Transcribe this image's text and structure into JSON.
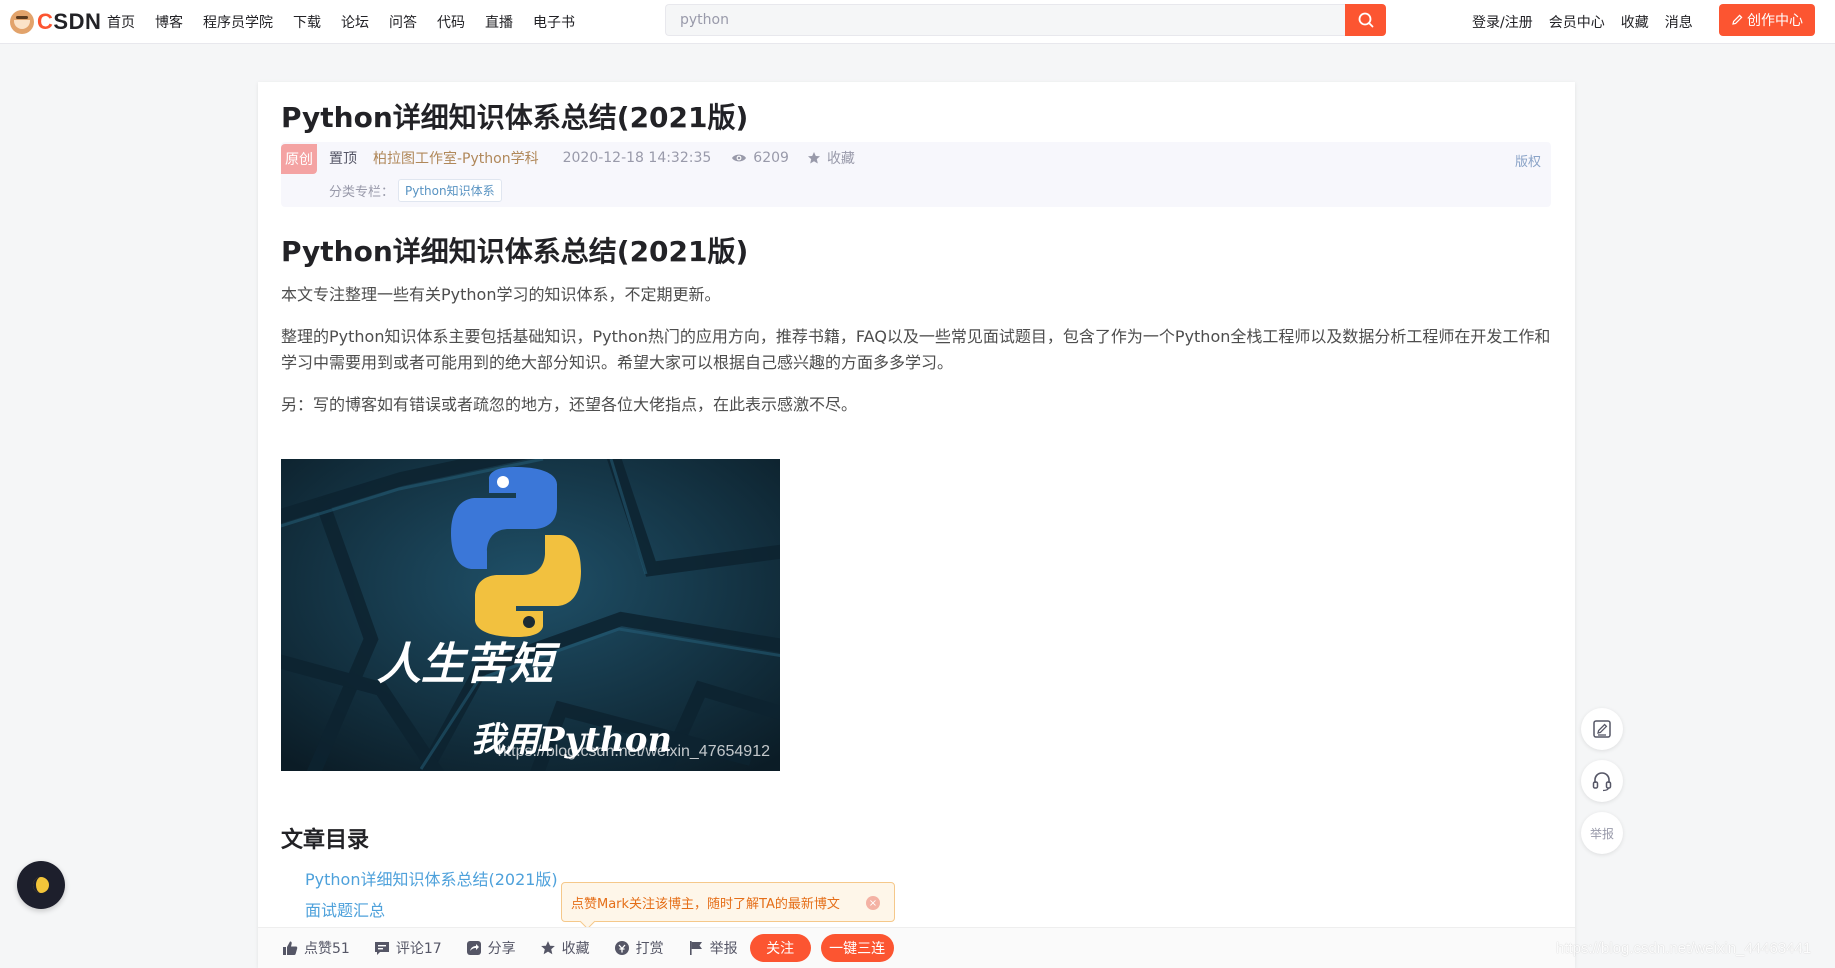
{
  "header": {
    "brand_prefix": "C",
    "brand_rest": "SDN",
    "nav": [
      "首页",
      "博客",
      "程序员学院",
      "下载",
      "论坛",
      "问答",
      "代码",
      "直播",
      "电子书"
    ],
    "search_value": "python",
    "right_nav": [
      "登录/注册",
      "会员中心",
      "收藏",
      "消息"
    ],
    "create_label": "创作中心",
    "accent": "#fc5531"
  },
  "article": {
    "title": "Python详细知识体系总结(2021版)",
    "original_badge": "原创",
    "pinned": "置顶",
    "author": "柏拉图工作室-Python学科",
    "date": "2020-12-18 14:32:35",
    "views": "6209",
    "favorite": "收藏",
    "copyright": "版权",
    "category_label": "分类专栏：",
    "category_tag": "Python知识体系",
    "heading": "Python详细知识体系总结(2021版)",
    "paragraphs": [
      "本文专注整理一些有关Python学习的知识体系，不定期更新。",
      "整理的Python知识体系主要包括基础知识，Python热门的应用方向，推荐书籍，FAQ以及一些常见面试题目，包含了作为一个Python全栈工程师以及数据分析工程师在开发工作和学习中需要用到或者可能用到的绝大部分知识。希望大家可以根据自己感兴趣的方面多多学习。",
      "另：写的博客如有错误或者疏忽的地方，还望各位大佬指点，在此表示感激不尽。"
    ],
    "image": {
      "calligraphy_line1": "人生苦短",
      "calligraphy_line2": "我用Python",
      "watermark": "https://blog.csdn.net/weixin_47654912"
    },
    "toc_title": "文章目录",
    "toc": [
      "Python详细知识体系总结(2021版)",
      "面试题汇总"
    ]
  },
  "tip": {
    "text": "点赞Mark关注该博主，随时了解TA的最新博文",
    "close": "×"
  },
  "toolbar": {
    "like": "点赞51",
    "comment": "评论17",
    "share": "分享",
    "favorite": "收藏",
    "reward": "打赏",
    "report": "举报",
    "follow": "关注",
    "triple": "一键三连"
  },
  "side_tools": {
    "report": "举报"
  },
  "page_watermark": "https://blog.csdn.net/weixin_44463441"
}
